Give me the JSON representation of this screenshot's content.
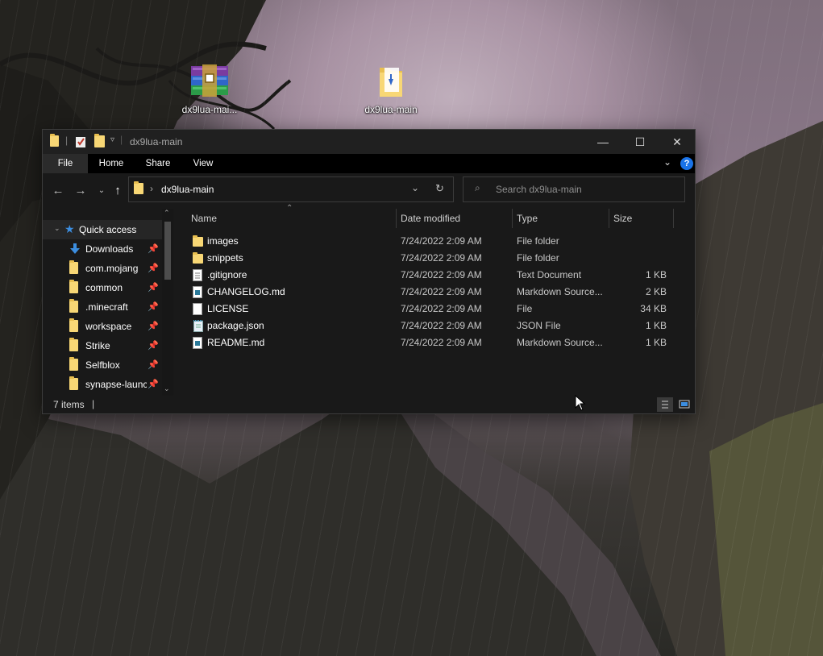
{
  "desktop": {
    "icons": [
      {
        "label": "dx9lua-mai...",
        "icon": "winrar-archive-icon"
      },
      {
        "label": "dx9lua-main",
        "icon": "folder-zip-icon"
      }
    ]
  },
  "window": {
    "title": "dx9lua-main",
    "controls": {
      "minimize": "—",
      "maximize": "☐",
      "close": "✕"
    }
  },
  "ribbon": {
    "tabs": [
      "File",
      "Home",
      "Share",
      "View"
    ],
    "active_tab": "File",
    "help": "?"
  },
  "address": {
    "path": "dx9lua-main",
    "search_placeholder": "Search dx9lua-main"
  },
  "nav": {
    "quick_access": "Quick access",
    "items": [
      {
        "label": "Downloads",
        "icon": "download-arrow-icon"
      },
      {
        "label": "com.mojang",
        "icon": "folder-icon"
      },
      {
        "label": "common",
        "icon": "folder-icon"
      },
      {
        "label": ".minecraft",
        "icon": "folder-icon"
      },
      {
        "label": "workspace",
        "icon": "folder-icon"
      },
      {
        "label": "Strike",
        "icon": "folder-icon"
      },
      {
        "label": "Selfblox",
        "icon": "folder-icon"
      },
      {
        "label": "synapse-launc",
        "icon": "folder-icon"
      }
    ]
  },
  "columns": {
    "name": "Name",
    "date": "Date modified",
    "type": "Type",
    "size": "Size"
  },
  "files": [
    {
      "name": "images",
      "date": "7/24/2022 2:09 AM",
      "type": "File folder",
      "size": "",
      "icon": "folder-icon"
    },
    {
      "name": "snippets",
      "date": "7/24/2022 2:09 AM",
      "type": "File folder",
      "size": "",
      "icon": "folder-icon"
    },
    {
      "name": ".gitignore",
      "date": "7/24/2022 2:09 AM",
      "type": "Text Document",
      "size": "1 KB",
      "icon": "text-file-icon"
    },
    {
      "name": "CHANGELOG.md",
      "date": "7/24/2022 2:09 AM",
      "type": "Markdown Source...",
      "size": "2 KB",
      "icon": "markdown-file-icon"
    },
    {
      "name": "LICENSE",
      "date": "7/24/2022 2:09 AM",
      "type": "File",
      "size": "34 KB",
      "icon": "blank-file-icon"
    },
    {
      "name": "package.json",
      "date": "7/24/2022 2:09 AM",
      "type": "JSON File",
      "size": "1 KB",
      "icon": "json-file-icon"
    },
    {
      "name": "README.md",
      "date": "7/24/2022 2:09 AM",
      "type": "Markdown Source...",
      "size": "1 KB",
      "icon": "markdown-file-icon"
    }
  ],
  "status": {
    "count": "7 items"
  },
  "colors": {
    "accent": "#1a73e8",
    "folder": "#f8d775",
    "window_bg": "#191919"
  }
}
